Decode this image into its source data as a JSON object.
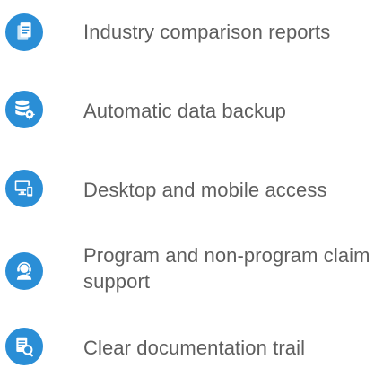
{
  "colors": {
    "icon_circle": "#2a8ed6",
    "icon_glyph": "#ffffff",
    "text": "#5e5e5e"
  },
  "features": [
    {
      "icon": "document-copy-icon",
      "label": "Industry comparison reports"
    },
    {
      "icon": "database-gear-icon",
      "label": "Automatic data backup"
    },
    {
      "icon": "desktop-mobile-icon",
      "label": "Desktop and mobile access"
    },
    {
      "icon": "headset-support-icon",
      "label": "Program and non-program claim support"
    },
    {
      "icon": "document-search-icon",
      "label": "Clear documentation trail"
    }
  ]
}
